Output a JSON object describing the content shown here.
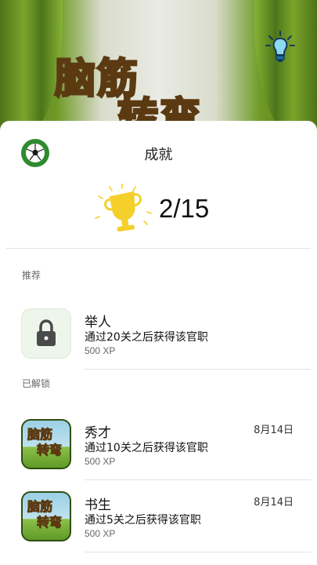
{
  "background": {
    "game_title_line1": "脑筋",
    "game_title_line2": "转弯"
  },
  "sheet": {
    "title": "成就",
    "progress": "2/15"
  },
  "sections": {
    "recommended_label": "推荐",
    "unlocked_label": "已解锁"
  },
  "recommended": [
    {
      "title": "举人",
      "desc": "通过20关之后获得该官职",
      "xp": "500 XP",
      "locked": true
    }
  ],
  "unlocked": [
    {
      "title": "秀才",
      "desc": "通过10关之后获得该官职",
      "xp": "500 XP",
      "date": "8月14日",
      "icon_text_1": "脑筋",
      "icon_text_2": "转弯"
    },
    {
      "title": "书生",
      "desc": "通过5关之后获得该官职",
      "xp": "500 XP",
      "date": "8月14日",
      "icon_text_1": "脑筋",
      "icon_text_2": "转弯"
    }
  ],
  "colors": {
    "trophy": "#f5cf2a",
    "accent_green": "#2f8a2f"
  }
}
